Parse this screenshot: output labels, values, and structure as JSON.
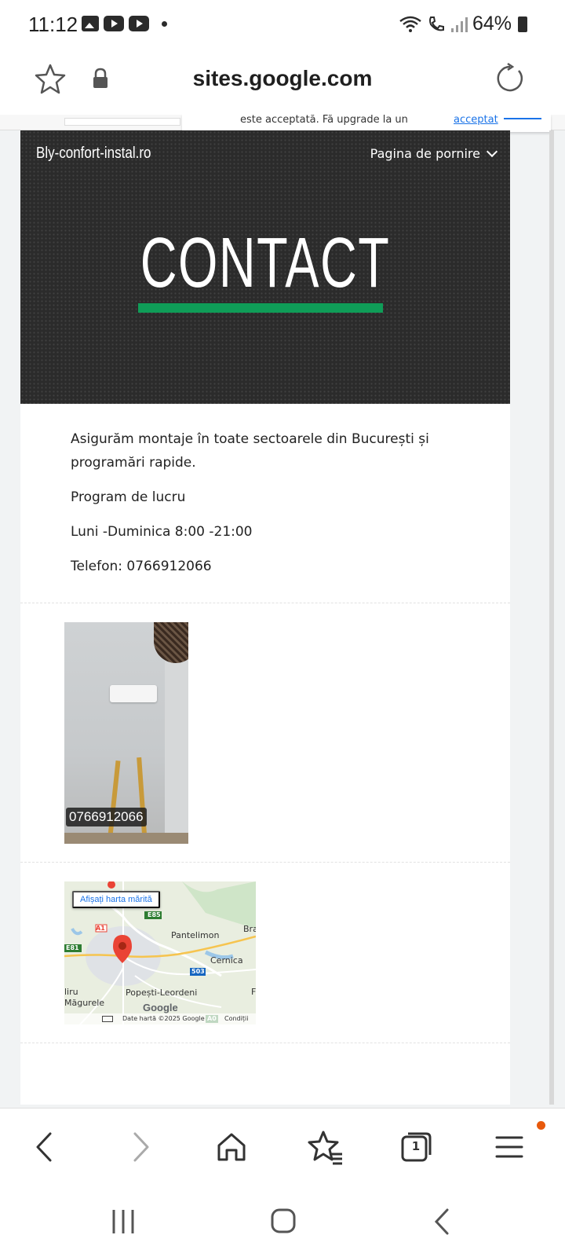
{
  "status_bar": {
    "time": "11:12",
    "battery": "64%",
    "icons": [
      "image-notification-icon",
      "youtube-icon",
      "youtube-icon",
      "dot-icon",
      "wifi-icon",
      "wifi-call-icon",
      "signal-icon",
      "battery-icon"
    ]
  },
  "browser": {
    "url": "sites.google.com",
    "notice_text": "este acceptată. Fă upgrade la un",
    "notice_link": "acceptat",
    "tab_count": "1"
  },
  "site": {
    "name": "Bly-confort-instal.ro",
    "nav_label": "Pagina de pornire",
    "hero_title": "CONTACT",
    "accent_color": "#0f9d58",
    "info": [
      "Asigurăm montaje în toate sectoarele din București și programări rapide.",
      "Program de lucru",
      "Luni -Duminica 8:00 -21:00",
      "Telefon: 0766912066"
    ],
    "photo_caption": "0766912066"
  },
  "map": {
    "enlarge_button": "Afișați harta mărită",
    "labels": {
      "pantelimon": "Pantelimon",
      "cernica": "Cernica",
      "popesti": "Popești-Leordeni",
      "magurele": "Măgurele",
      "liru": "liru",
      "bra": "Bra",
      "f": "F",
      "e85": "E85",
      "e81": "E81",
      "a1": "A1",
      "r503": "503",
      "a0": "A0"
    },
    "google": "Google",
    "data_credit": "Date hartă ©2025 Google",
    "terms": "Condiții"
  }
}
